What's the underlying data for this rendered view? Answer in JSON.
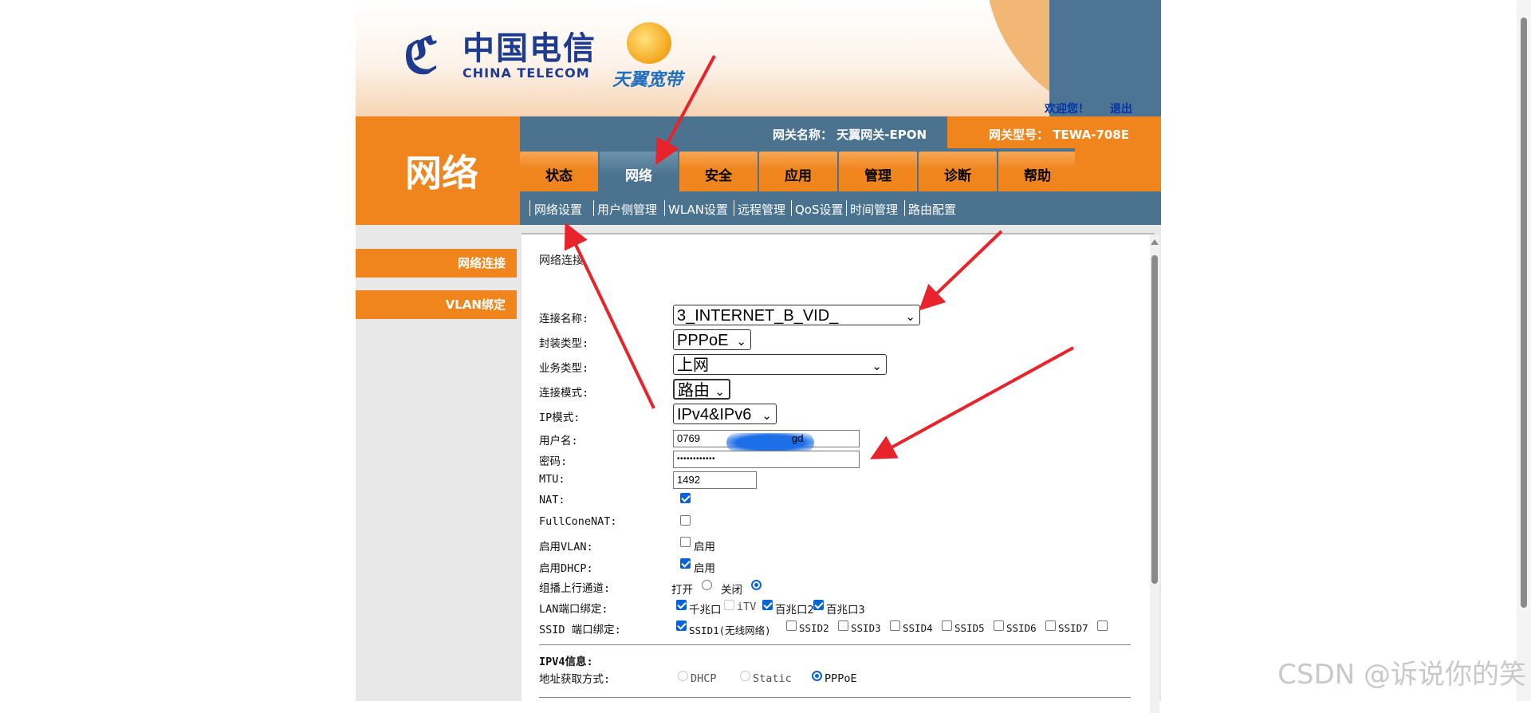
{
  "header": {
    "brand_cn": "中国电信",
    "brand_en": "CHINA TELECOM",
    "sub_brand": "天翼宽带",
    "welcome": "欢迎您！",
    "logout": "退出",
    "gateway_name_label": "网关名称：  天翼网关-EPON",
    "gateway_type_label": "网关型号：  TEWA-708E"
  },
  "section_title": "网络",
  "tabs": [
    {
      "label": "状态"
    },
    {
      "label": "网络"
    },
    {
      "label": "安全"
    },
    {
      "label": "应用"
    },
    {
      "label": "管理"
    },
    {
      "label": "诊断"
    },
    {
      "label": "帮助"
    }
  ],
  "subnav": [
    {
      "label": "网络设置"
    },
    {
      "label": "用户侧管理"
    },
    {
      "label": "WLAN设置"
    },
    {
      "label": "远程管理"
    },
    {
      "label": "QoS设置"
    },
    {
      "label": "时间管理"
    },
    {
      "label": "路由配置"
    }
  ],
  "sidebar": [
    {
      "label": "网络连接"
    },
    {
      "label": "VLAN绑定"
    }
  ],
  "form": {
    "section_heading": "网络连接",
    "connection_name": {
      "label": "连接名称:",
      "value": "3_INTERNET_B_VID_"
    },
    "encap_type": {
      "label": "封装类型:",
      "value": "PPPoE"
    },
    "service_type": {
      "label": "业务类型:",
      "value": "上网"
    },
    "connection_mode": {
      "label": "连接模式:",
      "value": "路由"
    },
    "ip_mode": {
      "label": "IP模式:",
      "value": "IPv4&IPv6"
    },
    "username": {
      "label": "用户名:",
      "value_prefix": "0769",
      "value_suffix": "gd"
    },
    "password": {
      "label": "密码:",
      "value": "••••••••••••"
    },
    "mtu": {
      "label": "MTU:",
      "value": "1492"
    },
    "nat": {
      "label": "NAT:",
      "checked": true
    },
    "fullcone_nat": {
      "label": "FullConeNAT:",
      "checked": false
    },
    "enable_vlan": {
      "label": "启用VLAN:",
      "option": "启用",
      "checked": false
    },
    "enable_dhcp": {
      "label": "启用DHCP:",
      "option": "启用",
      "checked": true
    },
    "multicast": {
      "label": "组播上行通道:",
      "on": "打开",
      "off": "关闭",
      "selected": "关闭"
    },
    "lan_binding": {
      "label": "LAN端口绑定:",
      "ports": [
        {
          "name": "千兆口",
          "checked": true,
          "disabled": false
        },
        {
          "name": "iTV",
          "checked": false,
          "disabled": true
        },
        {
          "name": "百兆口2",
          "checked": true,
          "disabled": false
        },
        {
          "name": "百兆口3",
          "checked": true,
          "disabled": false
        }
      ]
    },
    "ssid_binding": {
      "label": "SSID 端口绑定:",
      "ssids": [
        {
          "name": "SSID1(无线网络)",
          "checked": true
        },
        {
          "name": "SSID2",
          "checked": false
        },
        {
          "name": "SSID3",
          "checked": false
        },
        {
          "name": "SSID4",
          "checked": false
        },
        {
          "name": "SSID5",
          "checked": false
        },
        {
          "name": "SSID6",
          "checked": false
        },
        {
          "name": "SSID7",
          "checked": false
        },
        {
          "name": "",
          "checked": false
        }
      ]
    },
    "ipv4_heading": "IPV4信息:",
    "address_mode": {
      "label": "地址获取方式:",
      "options": [
        "DHCP",
        "Static",
        "PPPoE"
      ],
      "selected": "PPPoE"
    }
  },
  "watermark": "CSDN @诉说你的笑",
  "colors": {
    "orange": "#ef851c",
    "steel_blue": "#4b7390",
    "link_blue": "#0033aa",
    "arrow_red": "#e8232b"
  }
}
